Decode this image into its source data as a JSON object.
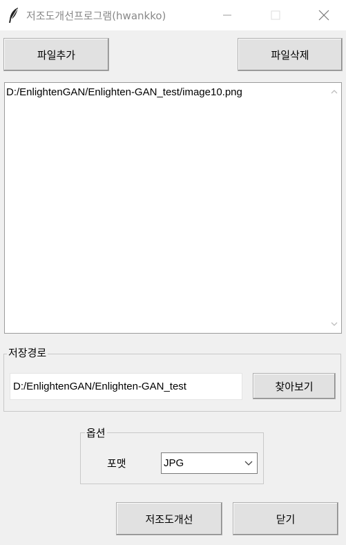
{
  "window": {
    "title": "저조도개선프로그램(hwankko)",
    "icon": "feather-icon"
  },
  "toolbar": {
    "add_file_label": "파일추가",
    "delete_file_label": "파일삭제"
  },
  "file_list": {
    "items": [
      "D:/EnlightenGAN/Enlighten-GAN_test/image10.png"
    ]
  },
  "save_path": {
    "group_label": "저장경로",
    "value": "D:/EnlightenGAN/Enlighten-GAN_test",
    "browse_label": "찾아보기"
  },
  "options": {
    "group_label": "옵션",
    "format_label": "포맷",
    "format_value": "JPG"
  },
  "actions": {
    "enhance_label": "저조도개선",
    "close_label": "닫기"
  }
}
